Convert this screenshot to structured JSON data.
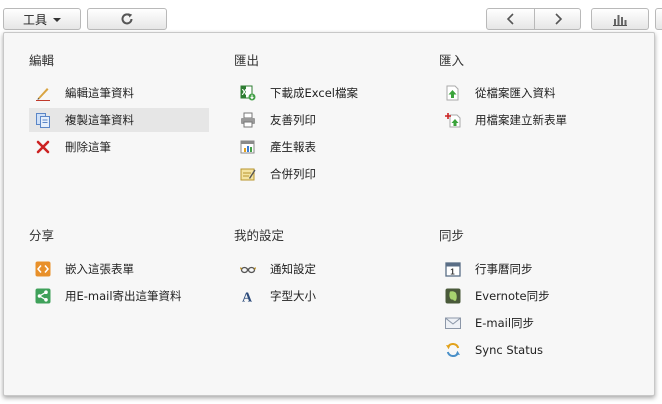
{
  "toolbar": {
    "tools_label": "工具",
    "refresh_icon": "refresh-icon",
    "prev_icon": "chevron-left-icon",
    "next_icon": "chevron-right-icon",
    "chart_icon": "bar-chart-icon"
  },
  "menu": {
    "edit": {
      "title": "編輯",
      "items": [
        {
          "label": "編輯這筆資料",
          "icon": "pencil-icon"
        },
        {
          "label": "複製這筆資料",
          "icon": "copy-icon"
        },
        {
          "label": "刪除這筆",
          "icon": "delete-icon"
        }
      ]
    },
    "export": {
      "title": "匯出",
      "items": [
        {
          "label": "下載成Excel檔案",
          "icon": "excel-download-icon"
        },
        {
          "label": "友善列印",
          "icon": "printer-icon"
        },
        {
          "label": "產生報表",
          "icon": "report-icon"
        },
        {
          "label": "合併列印",
          "icon": "mail-merge-icon"
        }
      ]
    },
    "import": {
      "title": "匯入",
      "items": [
        {
          "label": "從檔案匯入資料",
          "icon": "file-import-icon"
        },
        {
          "label": "用檔案建立新表單",
          "icon": "new-form-from-file-icon"
        }
      ]
    },
    "share": {
      "title": "分享",
      "items": [
        {
          "label": "嵌入這張表單",
          "icon": "embed-icon"
        },
        {
          "label": "用E-mail寄出這筆資料",
          "icon": "share-icon"
        }
      ]
    },
    "settings": {
      "title": "我的設定",
      "items": [
        {
          "label": "通知設定",
          "icon": "glasses-icon"
        },
        {
          "label": "字型大小",
          "icon": "font-size-icon"
        }
      ]
    },
    "sync": {
      "title": "同步",
      "items": [
        {
          "label": "行事曆同步",
          "icon": "calendar-icon"
        },
        {
          "label": "Evernote同步",
          "icon": "evernote-icon"
        },
        {
          "label": "E-mail同步",
          "icon": "email-icon"
        },
        {
          "label": "Sync Status",
          "icon": "sync-icon"
        }
      ]
    }
  },
  "colors": {
    "menu_bg": "#f7f7f7",
    "highlight": "#e6e6e6",
    "delete_red": "#cc2222",
    "import_green": "#3aa33a",
    "embed_orange": "#e8902a",
    "share_green": "#3fa15a"
  }
}
